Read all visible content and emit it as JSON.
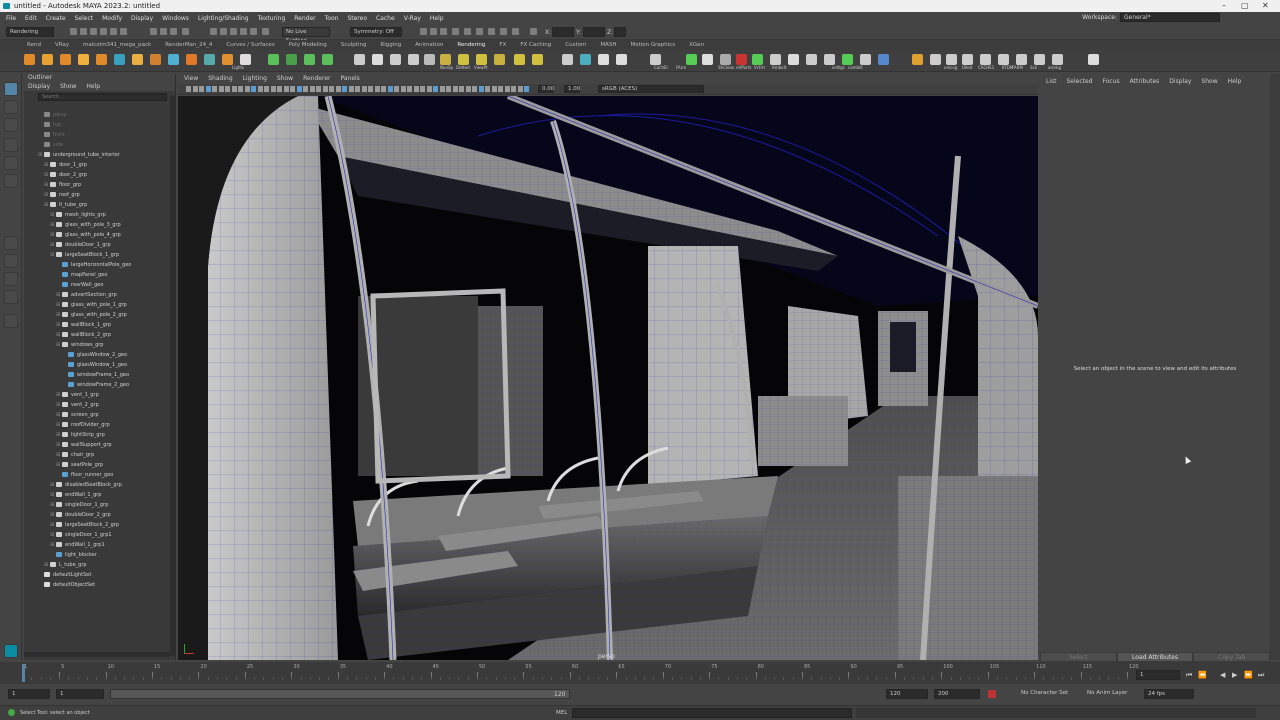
{
  "window": {
    "title": "untitled - Autodesk MAYA 2023.2: untitled",
    "controls": [
      "–",
      "▢",
      "✕"
    ]
  },
  "menubar": {
    "items": [
      "File",
      "Edit",
      "Create",
      "Select",
      "Modify",
      "Display",
      "Windows",
      "Lighting/Shading",
      "Texturing",
      "Render",
      "Toon",
      "Stereo",
      "Cache",
      "V-Ray",
      "Help"
    ],
    "workspace_label": "Workspace:",
    "workspace_value": "General*"
  },
  "status_line": {
    "menuset": "Rendering",
    "live_surface": "No Live Surface",
    "symmetry": "Symmetry: Off",
    "x_label": "X:",
    "y_label": "Y:",
    "z_label": "Z:"
  },
  "shelf_tabs": [
    "Rend",
    "VRay",
    "malcolm341_mega_pack",
    "RenderMan_24_4",
    "Curves / Surfaces",
    "Poly Modeling",
    "Sculpting",
    "Rigging",
    "Animation",
    "Rendering",
    "FX",
    "FX Caching",
    "Custom",
    "MASH",
    "Motion Graphics",
    "XGen"
  ],
  "shelf_labels": [
    "Lights",
    "NonSp",
    "Dotted",
    "ViewPt",
    "ShClean",
    "refParts",
    "Vctrtr",
    "Ambolt",
    "CachEl",
    "FArm",
    "unlcog",
    "Ulled",
    "CACHE1",
    "KTDM",
    "FARM",
    "Sck",
    "arnrkg",
    "ordtgs",
    "camblit"
  ],
  "outliner": {
    "title": "Outliner",
    "menu": [
      "Display",
      "Show",
      "Help"
    ],
    "search_placeholder": "Search...",
    "items": [
      {
        "label": "persp",
        "depth": 1,
        "dim": true,
        "type": "camera"
      },
      {
        "label": "top",
        "depth": 1,
        "dim": true,
        "type": "camera"
      },
      {
        "label": "front",
        "depth": 1,
        "dim": true,
        "type": "camera"
      },
      {
        "label": "side",
        "depth": 1,
        "dim": true,
        "type": "camera"
      },
      {
        "label": "underground_tube_interior",
        "depth": 1,
        "type": "group"
      },
      {
        "label": "door_1_grp",
        "depth": 2,
        "type": "group"
      },
      {
        "label": "door_2_grp",
        "depth": 2,
        "type": "group"
      },
      {
        "label": "floor_grp",
        "depth": 2,
        "type": "group"
      },
      {
        "label": "roof_grp",
        "depth": 2,
        "type": "group"
      },
      {
        "label": "tl_tube_grp",
        "depth": 2,
        "type": "group"
      },
      {
        "label": "mesh_lights_grp",
        "depth": 3,
        "type": "group"
      },
      {
        "label": "glass_with_pole_3_grp",
        "depth": 3,
        "type": "group"
      },
      {
        "label": "glass_with_pole_4_grp",
        "depth": 3,
        "type": "group"
      },
      {
        "label": "doubleDoor_1_grp",
        "depth": 3,
        "type": "group"
      },
      {
        "label": "largeSeatBlock_1_grp",
        "depth": 3,
        "type": "group"
      },
      {
        "label": "largeHorizontalPole_geo",
        "depth": 4,
        "type": "mesh"
      },
      {
        "label": "mapPanel_geo",
        "depth": 4,
        "type": "mesh"
      },
      {
        "label": "rearWall_geo",
        "depth": 4,
        "type": "mesh"
      },
      {
        "label": "advertSection_grp",
        "depth": 4,
        "type": "group"
      },
      {
        "label": "glass_with_pole_1_grp",
        "depth": 4,
        "type": "group"
      },
      {
        "label": "glass_with_pole_2_grp",
        "depth": 4,
        "type": "group"
      },
      {
        "label": "wallBlock_1_grp",
        "depth": 4,
        "type": "group"
      },
      {
        "label": "wallBlock_2_grp",
        "depth": 4,
        "type": "group"
      },
      {
        "label": "windows_grp",
        "depth": 4,
        "type": "group"
      },
      {
        "label": "glassWindow_2_geo",
        "depth": 5,
        "type": "mesh"
      },
      {
        "label": "glassWindow_1_geo",
        "depth": 5,
        "type": "mesh"
      },
      {
        "label": "windowFrame_1_geo",
        "depth": 5,
        "type": "mesh"
      },
      {
        "label": "windowFrame_2_geo",
        "depth": 5,
        "type": "mesh"
      },
      {
        "label": "vent_1_grp",
        "depth": 4,
        "type": "group"
      },
      {
        "label": "vent_2_grp",
        "depth": 4,
        "type": "group"
      },
      {
        "label": "screen_grp",
        "depth": 4,
        "type": "group"
      },
      {
        "label": "roofDivider_grp",
        "depth": 4,
        "type": "group"
      },
      {
        "label": "lightStrip_grp",
        "depth": 4,
        "type": "group"
      },
      {
        "label": "wallSupport_grp",
        "depth": 4,
        "type": "group"
      },
      {
        "label": "chair_grp",
        "depth": 4,
        "type": "group"
      },
      {
        "label": "seatPole_grp",
        "depth": 4,
        "type": "group"
      },
      {
        "label": "floor_runner_geo",
        "depth": 4,
        "type": "mesh"
      },
      {
        "label": "disabledSeatBlock_grp",
        "depth": 3,
        "type": "group"
      },
      {
        "label": "endWall_1_grp",
        "depth": 3,
        "type": "group"
      },
      {
        "label": "singleDoor_1_grp",
        "depth": 3,
        "type": "group"
      },
      {
        "label": "doubleDoor_2_grp",
        "depth": 3,
        "type": "group"
      },
      {
        "label": "largeSeatBlock_2_grp",
        "depth": 3,
        "type": "group"
      },
      {
        "label": "singleDoor_1_grp1",
        "depth": 3,
        "type": "group"
      },
      {
        "label": "endWall_1_grp1",
        "depth": 3,
        "type": "group"
      },
      {
        "label": "light_blocker",
        "depth": 3,
        "type": "mesh"
      },
      {
        "label": "L_tube_grp",
        "depth": 2,
        "type": "group"
      },
      {
        "label": "defaultLightSet",
        "depth": 1,
        "type": "set"
      },
      {
        "label": "defaultObjectSet",
        "depth": 1,
        "type": "set"
      }
    ]
  },
  "viewport": {
    "menu": [
      "View",
      "Shading",
      "Lighting",
      "Show",
      "Renderer",
      "Panels"
    ],
    "exposure": "0.00",
    "gamma": "1.00",
    "colorspace": "sRGB (ACES)",
    "camera_label": "persp"
  },
  "attribute_editor": {
    "menu": [
      "List",
      "Selected",
      "Focus",
      "Attributes",
      "Display",
      "Show",
      "Help"
    ],
    "message": "Select an object in the scene to view and edit its attributes",
    "buttons": [
      "Select",
      "Load Attributes",
      "Copy Tab"
    ]
  },
  "time": {
    "ticks": [
      1,
      5,
      10,
      15,
      20,
      25,
      30,
      35,
      40,
      45,
      50,
      55,
      60,
      65,
      70,
      75,
      80,
      85,
      90,
      95,
      100,
      105,
      110,
      115,
      120
    ],
    "current_frame": "1",
    "range_start": "1",
    "range_inner_start": "1",
    "range_inner_end": "120",
    "range_end_1": "120",
    "range_end_2": "200",
    "character_set": "No Character Set",
    "anim_layer": "No Anim Layer",
    "fps": "24 fps"
  },
  "command": {
    "help_line": "Select Tool: select an object",
    "lang": "MEL"
  },
  "colors": {
    "wire": "#2a2ab8",
    "accent": "#5285a6",
    "highlight": "#4c7ea0"
  }
}
